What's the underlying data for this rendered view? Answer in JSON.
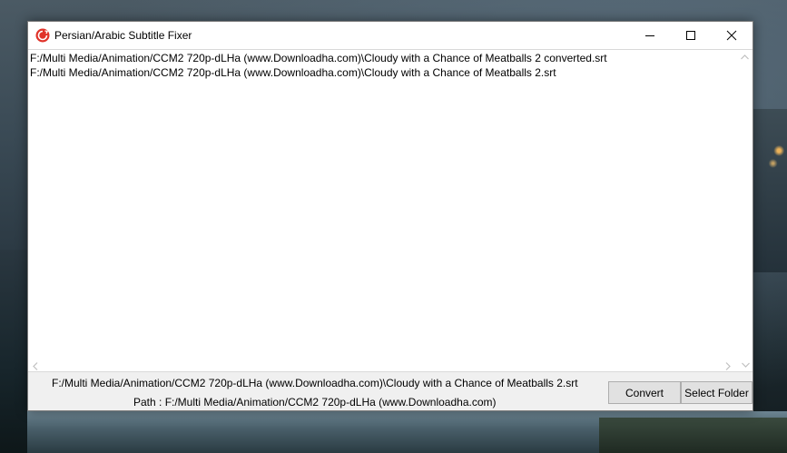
{
  "window": {
    "title": "Persian/Arabic Subtitle Fixer",
    "app_icon": "red-circle-arrow-icon",
    "controls": {
      "minimize_icon": "minimize-icon",
      "maximize_icon": "maximize-icon",
      "close_icon": "close-icon"
    }
  },
  "file_list": {
    "items": [
      "F:/Multi Media/Animation/CCM2 720p-dLHa (www.Downloadha.com)\\Cloudy with a Chance of Meatballs 2 converted.srt",
      "F:/Multi Media/Animation/CCM2 720p-dLHa (www.Downloadha.com)\\Cloudy with a Chance of Meatballs 2.srt"
    ]
  },
  "status": {
    "selected_file": "F:/Multi Media/Animation/CCM2 720p-dLHa (www.Downloadha.com)\\Cloudy with a Chance of Meatballs 2.srt",
    "path_line": "Path : F:/Multi Media/Animation/CCM2 720p-dLHa (www.Downloadha.com)"
  },
  "buttons": {
    "convert_label": "Convert",
    "select_folder_label": "Select Folder"
  },
  "colors": {
    "app_icon_red": "#e0332a",
    "window_bg": "#f0f0f0",
    "button_bg": "#e1e1e1"
  }
}
